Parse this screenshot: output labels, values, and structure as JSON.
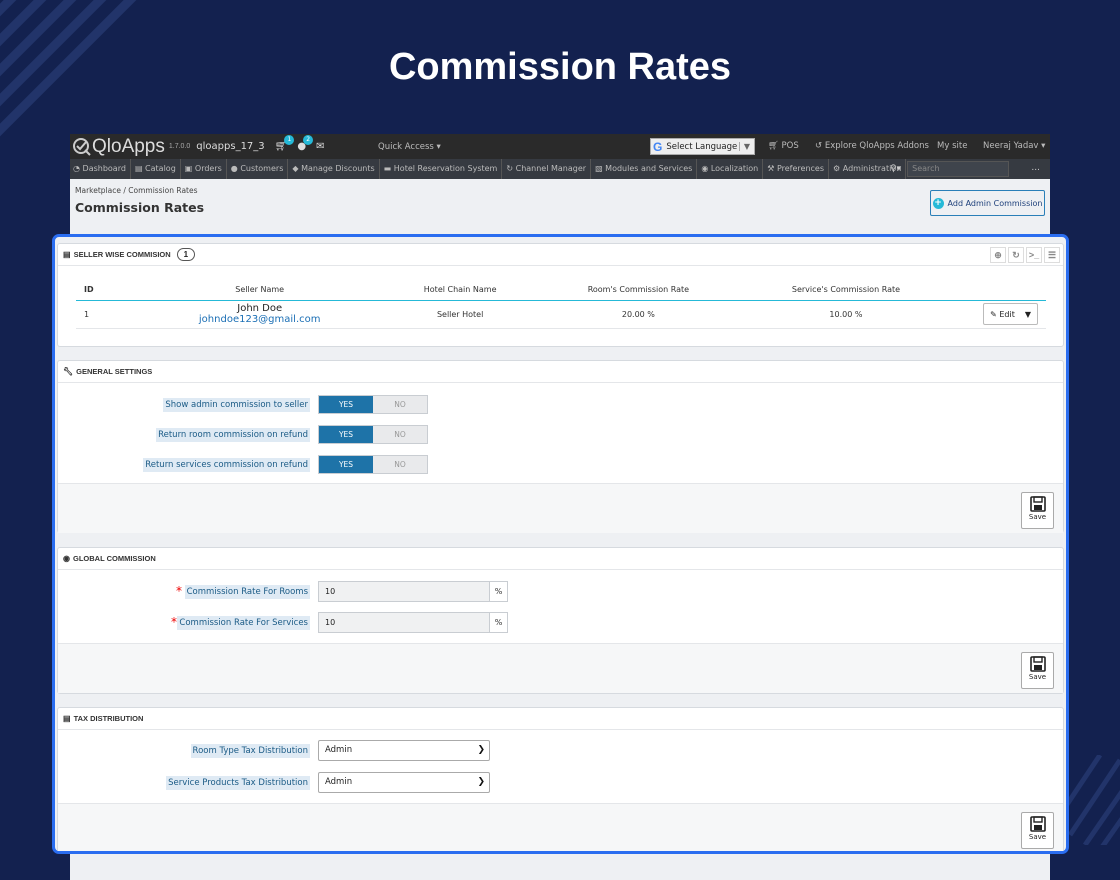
{
  "hero": {
    "title": "Commission Rates"
  },
  "topbar": {
    "brand": "QloApps",
    "version": "1.7.0.0",
    "shop": "qloapps_17_3",
    "cart_badge": "1",
    "user_badge": "2",
    "quick_access": "Quick Access",
    "language": "Select Language",
    "pos": "POS",
    "addons": "Explore QloApps Addons",
    "mysite": "My site",
    "user": "Neeraj Yadav"
  },
  "menu": {
    "items": [
      {
        "label": "Dashboard",
        "icon": "dashboard-icon"
      },
      {
        "label": "Catalog",
        "icon": "book-icon"
      },
      {
        "label": "Orders",
        "icon": "orders-icon"
      },
      {
        "label": "Customers",
        "icon": "users-icon"
      },
      {
        "label": "Manage Discounts",
        "icon": "tag-icon"
      },
      {
        "label": "Hotel Reservation System",
        "icon": "bed-icon"
      },
      {
        "label": "Channel Manager",
        "icon": "refresh-icon"
      },
      {
        "label": "Modules and Services",
        "icon": "puzzle-icon"
      },
      {
        "label": "Localization",
        "icon": "globe-icon"
      },
      {
        "label": "Preferences",
        "icon": "wrench-icon"
      },
      {
        "label": "Administration",
        "icon": "gear-icon"
      }
    ],
    "search_placeholder": "Search",
    "more": "..."
  },
  "header": {
    "breadcrumb": "Marketplace  /  Commission Rates",
    "title": "Commission Rates",
    "add_button": "Add Admin Commission"
  },
  "seller": {
    "title": "SELLER WISE COMMISION",
    "count": "1",
    "columns": [
      "ID",
      "Seller Name",
      "Hotel Chain Name",
      "Room's Commission Rate",
      "Service's Commission Rate"
    ],
    "rows": [
      {
        "id": "1",
        "name": "John Doe",
        "email": "johndoe123@gmail.com",
        "hotel": "Seller Hotel",
        "room_rate": "20.00 %",
        "service_rate": "10.00 %"
      }
    ],
    "edit_label": "Edit"
  },
  "general": {
    "title": "GENERAL SETTINGS",
    "yes": "YES",
    "no": "NO",
    "fields": [
      {
        "label": "Show admin commission to seller",
        "value": "YES"
      },
      {
        "label": "Return room commission on refund",
        "value": "YES"
      },
      {
        "label": "Return services commission on refund",
        "value": "YES"
      }
    ],
    "save": "Save"
  },
  "global": {
    "title": "GLOBAL COMMISSION",
    "rooms_label": "Commission Rate For Rooms",
    "rooms_value": "10",
    "services_label": "Commission Rate For Services",
    "services_value": "10",
    "unit": "%",
    "required_mark": "*",
    "save": "Save"
  },
  "tax": {
    "title": "TAX DISTRIBUTION",
    "room_label": "Room Type Tax Distribution",
    "room_value": "Admin",
    "service_label": "Service Products Tax Distribution",
    "service_value": "Admin",
    "save": "Save"
  },
  "colors": {
    "background": "#13214f",
    "accent": "#25b9d7",
    "toggle_on": "#1e73a8",
    "highlight": "#2a6df0"
  }
}
